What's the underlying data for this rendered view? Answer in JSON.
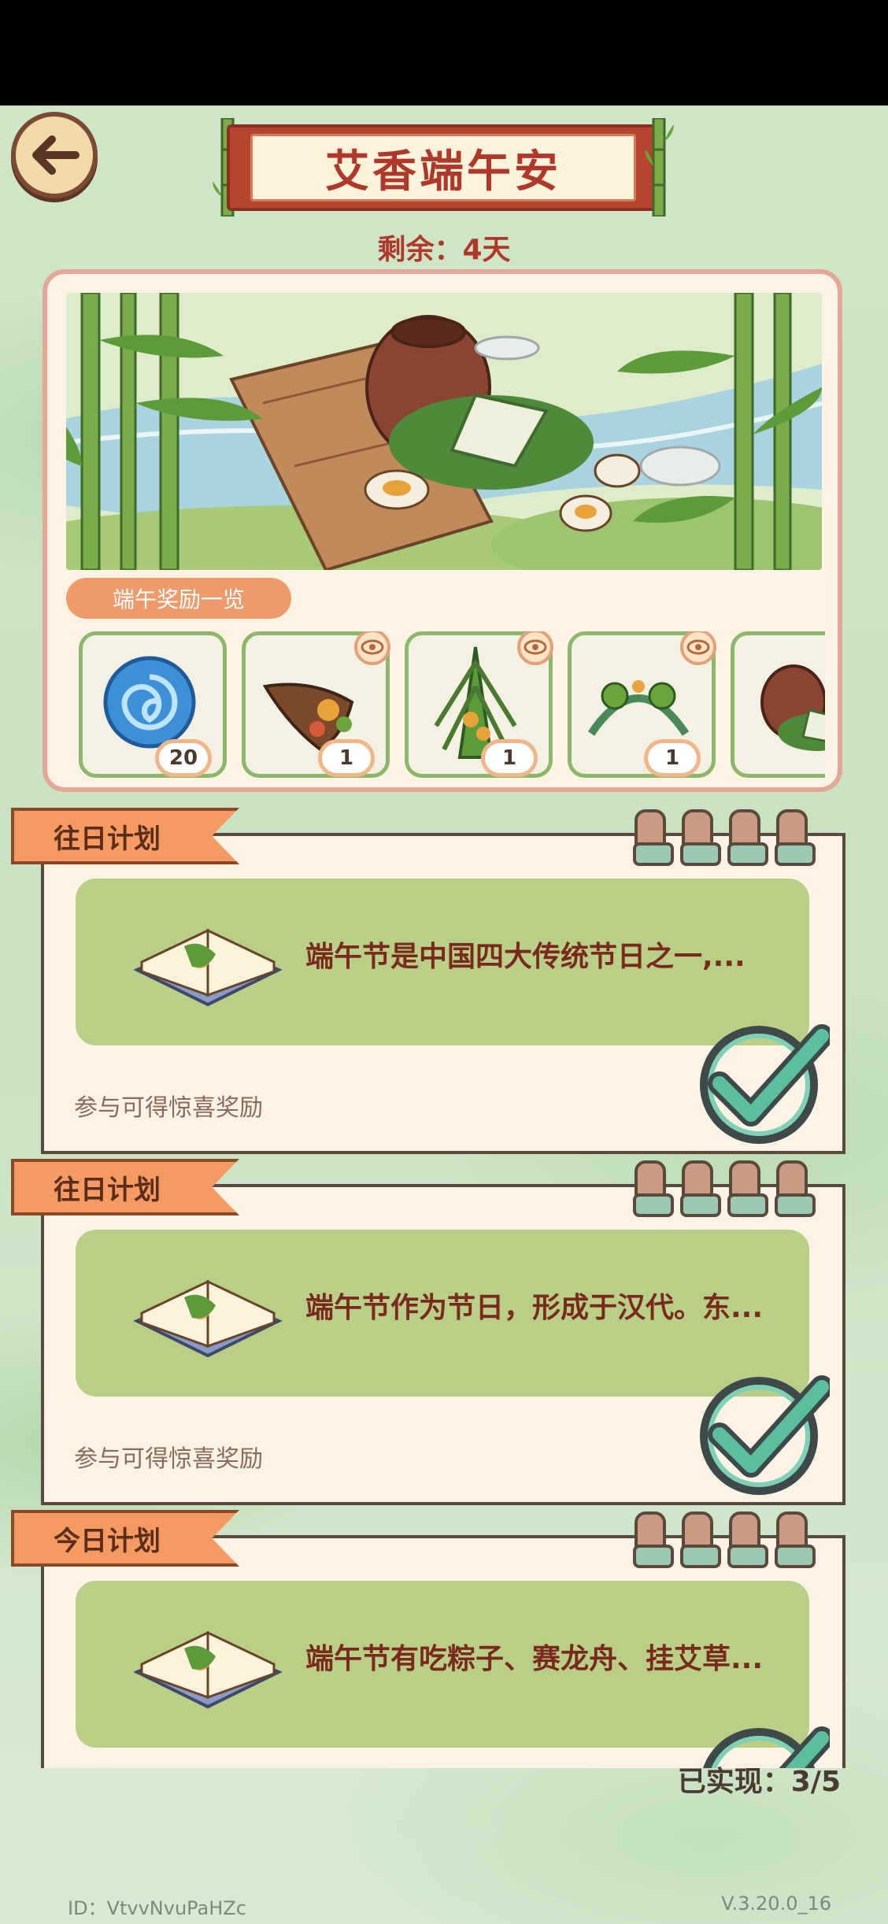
{
  "header": {
    "title": "艾香端午安",
    "remaining": "剩余：4天"
  },
  "rewards": {
    "tag_label": "端午奖励一览",
    "items": [
      {
        "icon": "swirl-orb-icon",
        "count": "20"
      },
      {
        "icon": "cornucopia-icon",
        "count": "1"
      },
      {
        "icon": "mugwort-bundle-icon",
        "count": "1"
      },
      {
        "icon": "headband-icon",
        "count": "1"
      },
      {
        "icon": "jar-zongzi-icon"
      }
    ]
  },
  "plans": [
    {
      "tab": "往日计划",
      "description": "端午节是中国四大传统节日之一,...",
      "hint": "参与可得惊喜奖励",
      "completed": true
    },
    {
      "tab": "往日计划",
      "description": "端午节作为节日，形成于汉代。东...",
      "hint": "参与可得惊喜奖励",
      "completed": true
    },
    {
      "tab": "今日计划",
      "description": "端午节有吃粽子、赛龙舟、挂艾草...",
      "completed": true
    }
  ],
  "progress": {
    "label": "已实现：3/5"
  },
  "footer": {
    "id": "ID：VtvvNvuPaHZc",
    "version": "V.3.20.0_16"
  },
  "colors": {
    "accent_red": "#b0382a",
    "tab_orange": "#f59a63",
    "content_green": "#b9cf86",
    "check_teal": "#5bbf9f"
  }
}
